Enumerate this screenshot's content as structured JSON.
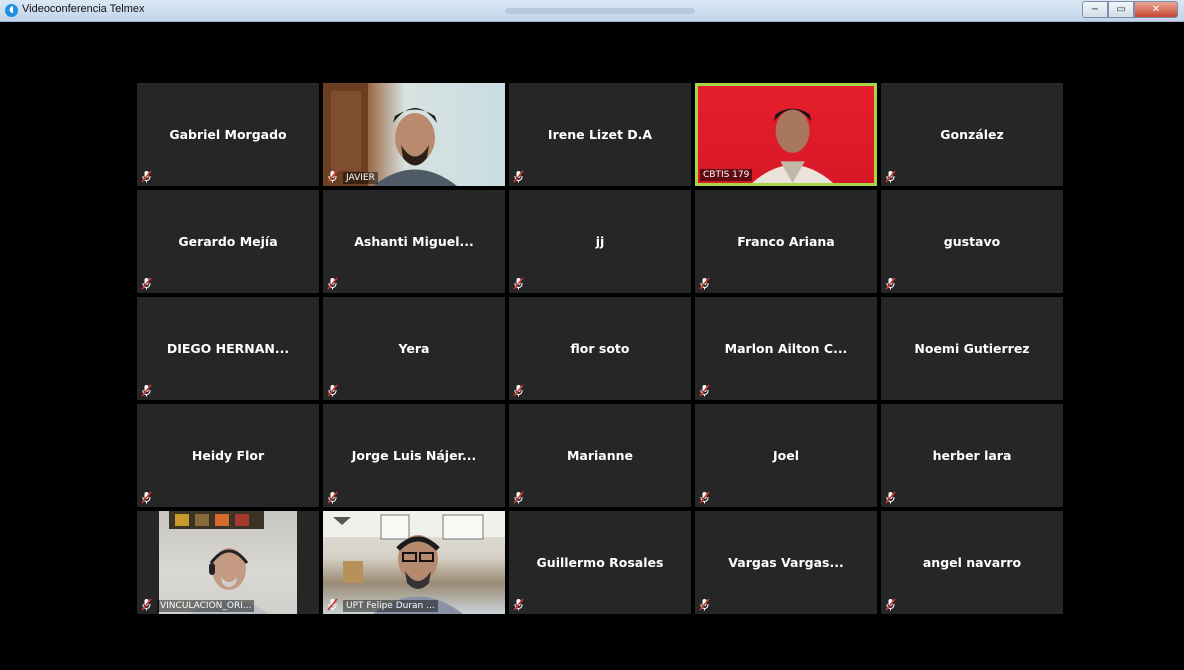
{
  "window": {
    "title": "Videoconferencia Telmex",
    "controls": {
      "minimize": "−",
      "restore": "▭",
      "close": "✕"
    }
  },
  "participants": [
    {
      "name": "Gabriel Morgado",
      "video": false,
      "muted": true
    },
    {
      "name": "JAVIER",
      "video": true,
      "muted": true
    },
    {
      "name": "Irene Lizet D.A",
      "video": false,
      "muted": true
    },
    {
      "name": "CBTIS 179",
      "video": true,
      "muted": false,
      "active_speaker": true
    },
    {
      "name": "González",
      "video": false,
      "muted": true
    },
    {
      "name": "Gerardo Mejía",
      "video": false,
      "muted": true
    },
    {
      "name": "Ashanti  Miguel...",
      "video": false,
      "muted": true
    },
    {
      "name": "jj",
      "video": false,
      "muted": true
    },
    {
      "name": "Franco Ariana",
      "video": false,
      "muted": true
    },
    {
      "name": "gustavo",
      "video": false,
      "muted": true
    },
    {
      "name": "DIEGO  HERNAN...",
      "video": false,
      "muted": true
    },
    {
      "name": "Yera",
      "video": false,
      "muted": true
    },
    {
      "name": "flor soto",
      "video": false,
      "muted": true
    },
    {
      "name": "Marlon  Ailton  C...",
      "video": false,
      "muted": true
    },
    {
      "name": "Noemi Gutierrez",
      "video": false,
      "muted": true
    },
    {
      "name": "Heidy Flor",
      "video": false,
      "muted": true
    },
    {
      "name": "Jorge Luis Nájer...",
      "video": false,
      "muted": true
    },
    {
      "name": "Marianne",
      "video": false,
      "muted": true
    },
    {
      "name": "Joel",
      "video": false,
      "muted": true
    },
    {
      "name": "herber lara",
      "video": false,
      "muted": true
    },
    {
      "name": "VINCULACION_ORI...",
      "video": true,
      "muted": true
    },
    {
      "name": "UPT Felipe Duran ...",
      "video": true,
      "muted": true
    },
    {
      "name": "Guillermo Rosales",
      "video": false,
      "muted": true
    },
    {
      "name": "Vargas  Vargas...",
      "video": false,
      "muted": true
    },
    {
      "name": "angel navarro",
      "video": false,
      "muted": true
    }
  ],
  "colors": {
    "tile_bg": "#262626",
    "active_border": "#a7d545",
    "muted_icon": "#d0342c"
  }
}
